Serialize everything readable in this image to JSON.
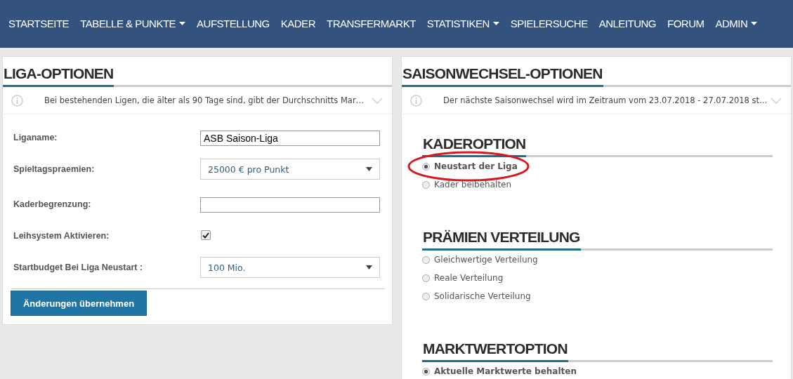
{
  "nav": {
    "items": [
      {
        "label": "STARTSEITE",
        "dropdown": false
      },
      {
        "label": "TABELLE & PUNKTE",
        "dropdown": true
      },
      {
        "label": "AUFSTELLUNG",
        "dropdown": false
      },
      {
        "label": "KADER",
        "dropdown": false
      },
      {
        "label": "TRANSFERMARKT",
        "dropdown": false
      },
      {
        "label": "STATISTIKEN",
        "dropdown": true
      },
      {
        "label": "SPIELERSUCHE",
        "dropdown": false
      },
      {
        "label": "ANLEITUNG",
        "dropdown": false
      },
      {
        "label": "FORUM",
        "dropdown": false
      },
      {
        "label": "ADMIN",
        "dropdown": true
      }
    ]
  },
  "liga_options": {
    "title": "LIGA-OPTIONEN",
    "info": "Bei bestehenden Ligen, die älter als 90 Tage sind, gibt der Durchschnitts Mar…",
    "fields": [
      {
        "kind": "text",
        "label": "Liganame:",
        "value": "ASB Saison-Liga"
      },
      {
        "kind": "select",
        "label": "Spieltagspraemien:",
        "value": "25000 € pro Punkt"
      },
      {
        "kind": "text",
        "label": "Kaderbegrenzung:"
      },
      {
        "kind": "checkbox",
        "label": "Leihsystem Aktivieren:",
        "checked": true
      },
      {
        "kind": "select",
        "label": "Startbudget Bei Liga Neustart :",
        "value": "100 Mio."
      }
    ],
    "submit": "Änderungen übernehmen"
  },
  "season_options": {
    "title": "SAISONWECHSEL-OPTIONEN",
    "info": "Der nächste Saisonwechsel wird im Zeitraum vom 23.07.2018 - 27.07.2018 st…",
    "groups": [
      {
        "title": "KADEROPTION",
        "options": [
          {
            "label": "Neustart der Liga",
            "selected": true,
            "highlighted": true
          },
          {
            "label": "Kader beibehalten",
            "selected": false,
            "highlighted": false
          }
        ]
      },
      {
        "title": "PRÄMIEN VERTEILUNG",
        "options": [
          {
            "label": "Gleichwertige Verteilung",
            "selected": false,
            "highlighted": false
          },
          {
            "label": "Reale Verteilung",
            "selected": false,
            "highlighted": false
          },
          {
            "label": "Solidarische Verteilung",
            "selected": false,
            "highlighted": false
          }
        ]
      },
      {
        "title": "MARKTWERTOPTION",
        "options": [
          {
            "label": "Aktuelle Marktwerte behalten",
            "selected": true,
            "highlighted": false
          }
        ]
      }
    ]
  }
}
